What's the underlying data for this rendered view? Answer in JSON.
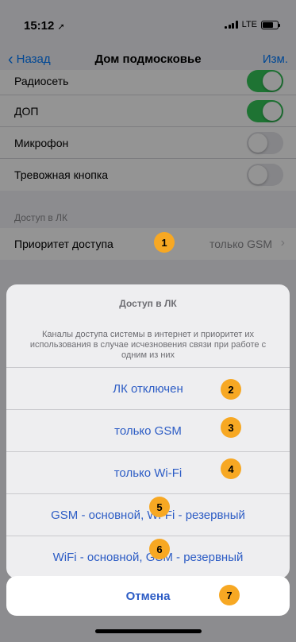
{
  "status_bar": {
    "time": "15:12",
    "network": "LTE",
    "location_icon": "location-arrow-icon"
  },
  "nav": {
    "back_label": "Назад",
    "title": "Дом подмосковье",
    "edit_label": "Изм."
  },
  "settings": [
    {
      "label": "Радиосеть",
      "toggle_on": true
    },
    {
      "label": "ДОП",
      "toggle_on": true
    },
    {
      "label": "Микрофон",
      "toggle_on": false
    },
    {
      "label": "Тревожная кнопка",
      "toggle_on": false
    }
  ],
  "access_section": {
    "header": "Доступ в ЛК",
    "row_label": "Приоритет доступа",
    "row_value": "только GSM"
  },
  "action_sheet": {
    "title": "Доступ в ЛК",
    "message": "Каналы доступа системы в интернет и приоритет их использования в случае исчезновения связи при работе с одним из них",
    "options": [
      "ЛК отключен",
      "только GSM",
      "только Wi-Fi",
      "GSM - основной, Wi-Fi - резервный",
      "WiFi - основной, GSM - резервный"
    ],
    "cancel_label": "Отмена"
  },
  "badges": [
    "1",
    "2",
    "3",
    "4",
    "5",
    "6",
    "7"
  ],
  "colors": {
    "accent": "#007aff",
    "sheet_text": "#2c5cc5",
    "toggle_on": "#34c759",
    "badge": "#f7a823"
  }
}
